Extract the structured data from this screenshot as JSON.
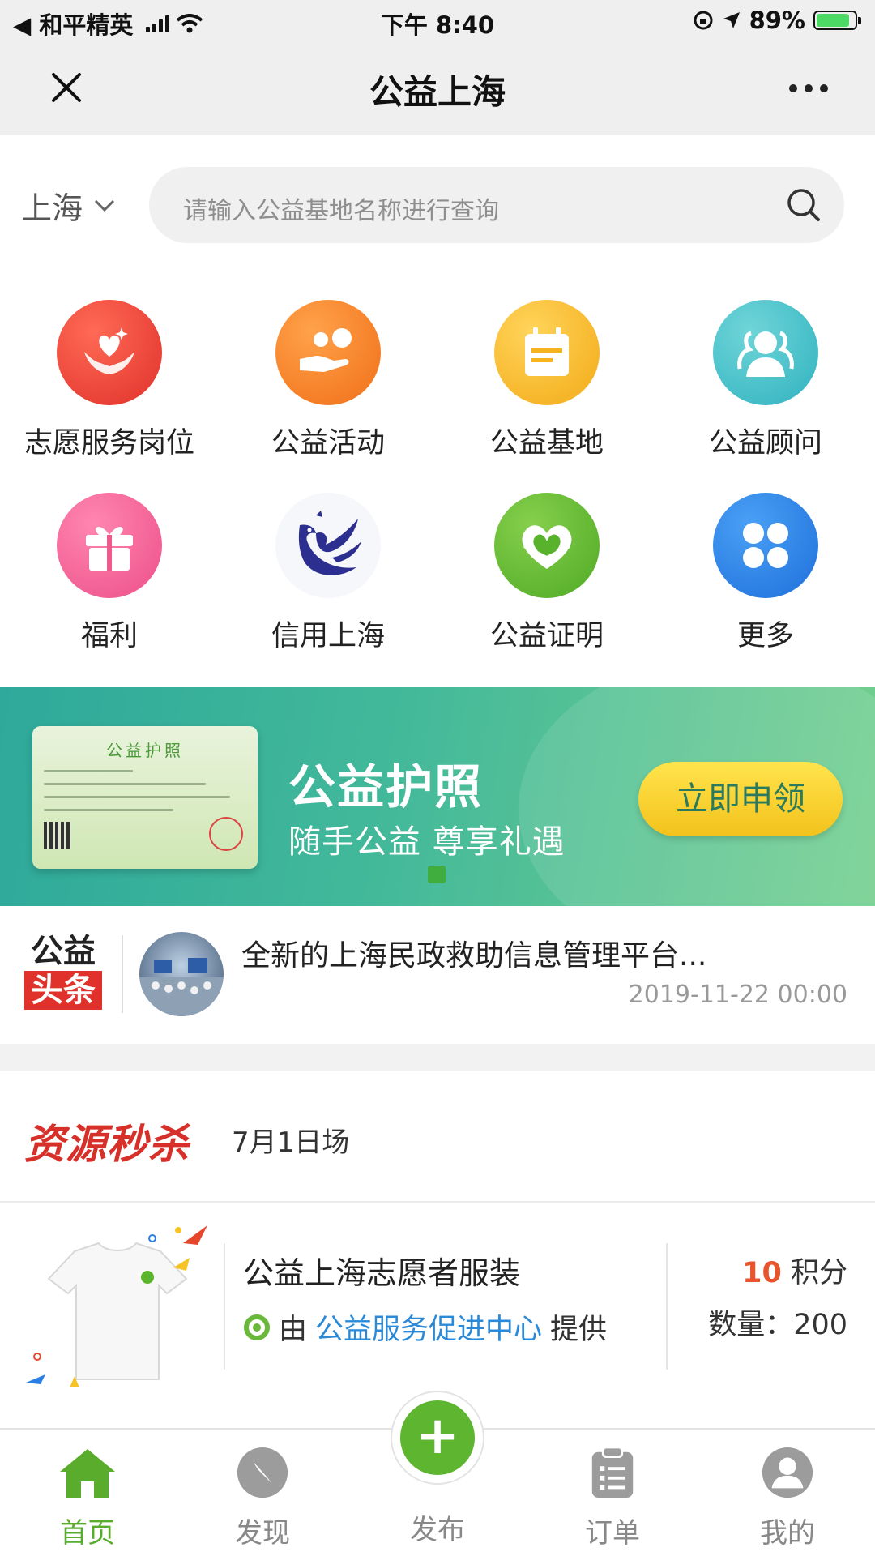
{
  "status_bar": {
    "back_app": "◀ 和平精英",
    "time": "下午 8:40",
    "battery": "89%"
  },
  "nav": {
    "title": "公益上海"
  },
  "search": {
    "city": "上海",
    "placeholder": "请输入公益基地名称进行查询"
  },
  "grid": [
    {
      "label": "志愿服务岗位",
      "icon": "heart-hands-icon",
      "color": "#ea3b33"
    },
    {
      "label": "公益活动",
      "icon": "hand-people-icon",
      "color": "#f67f1f"
    },
    {
      "label": "公益基地",
      "icon": "calendar-icon",
      "color": "#f5b21e"
    },
    {
      "label": "公益顾问",
      "icon": "consultant-icon",
      "color": "#3ec0c8"
    },
    {
      "label": "福利",
      "icon": "gift-icon",
      "color": "#f2598f"
    },
    {
      "label": "信用上海",
      "icon": "credit-shanghai-logo",
      "color": "#2c2f8f"
    },
    {
      "label": "公益证明",
      "icon": "heart-certificate-icon",
      "color": "#5bb52c"
    },
    {
      "label": "更多",
      "icon": "more-grid-icon",
      "color": "#2a7fe4"
    }
  ],
  "banner": {
    "card_title": "公益护照",
    "title": "公益护照",
    "subtitle": "随手公益 尊享礼遇",
    "button": "立即申领"
  },
  "news": {
    "logo_top": "公益",
    "logo_bottom": "头条",
    "title": "全新的上海民政救助信息管理平台...",
    "time": "2019-11-22 00:00"
  },
  "seckill": {
    "title": "资源秒杀",
    "date": "7月1日场",
    "item": {
      "name": "公益上海志愿者服装",
      "provider_prefix": "由",
      "provider": "公益服务促进中心",
      "provider_suffix": "提供",
      "points_value": "10",
      "points_unit": " 积分",
      "quantity": "数量：200"
    }
  },
  "tabs": [
    {
      "label": "首页",
      "icon": "home-icon",
      "active": true
    },
    {
      "label": "发现",
      "icon": "compass-icon",
      "active": false
    },
    {
      "label": "发布",
      "icon": "plus-icon",
      "active": false
    },
    {
      "label": "订单",
      "icon": "clipboard-icon",
      "active": false
    },
    {
      "label": "我的",
      "icon": "user-icon",
      "active": false
    }
  ],
  "colors": {
    "brand_green": "#5aac2c",
    "accent_red": "#d7302a",
    "link_blue": "#2b8ad8"
  }
}
